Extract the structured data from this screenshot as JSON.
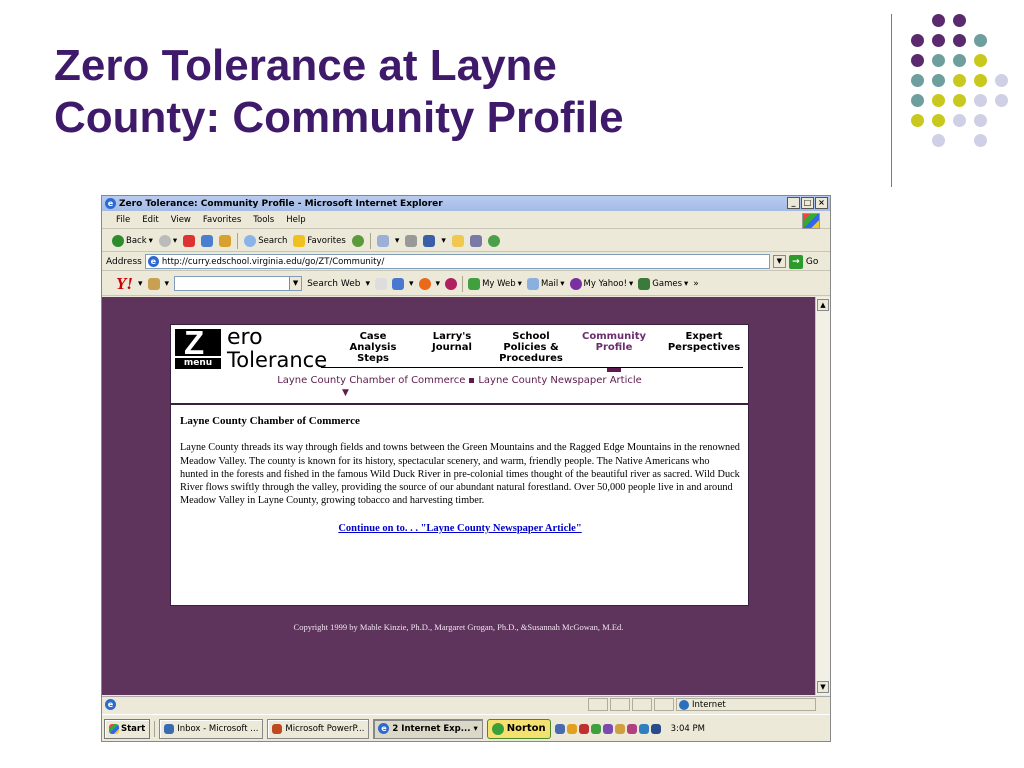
{
  "slide": {
    "title_line1": "Zero Tolerance at Layne",
    "title_line2": "County: Community Profile",
    "title_color": "#3f1a6b",
    "dot_colors": {
      "purple": "#5b2a6e",
      "teal": "#6e9f9e",
      "yellow": "#c8c81e",
      "lavender": "#cfd0e6"
    }
  },
  "window": {
    "title": "Zero Tolerance: Community Profile - Microsoft Internet Explorer",
    "controls": [
      "_",
      "□",
      "×"
    ]
  },
  "menubar": [
    "File",
    "Edit",
    "View",
    "Favorites",
    "Tools",
    "Help"
  ],
  "toolbar": {
    "back": "Back",
    "search": "Search",
    "favorites": "Favorites"
  },
  "address": {
    "label": "Address",
    "url": "http://curry.edschool.virginia.edu/go/ZT/Community/",
    "go": "Go"
  },
  "yahoo_toolbar": {
    "logo": "Y!",
    "search_btn": "Search Web",
    "my_web": "My Web",
    "mail": "Mail",
    "my_yahoo": "My Yahoo!",
    "games": "Games",
    "more": "»"
  },
  "site": {
    "logo_letter": "Z",
    "logo_menu": "menu",
    "logo_text1": "ero",
    "logo_text2": "Tolerance",
    "nav": [
      {
        "label": "Case Analysis Steps"
      },
      {
        "label": "Larry's Journal"
      },
      {
        "label": "School Policies & Procedures"
      },
      {
        "label": "Community Profile"
      },
      {
        "label": "Expert Perspectives"
      }
    ],
    "subnav_1": "Layne County Chamber of Commerce",
    "subnav_2": "Layne County Newspaper Article",
    "heading": "Layne County Chamber of Commerce",
    "paragraph": "Layne County threads its way through fields and towns between the Green Mountains and the Ragged Edge Mountains in the renowned Meadow Valley. The county is known for its history, spectacular scenery, and warm, friendly people. The Native Americans who hunted in the forests and fished in the famous Wild Duck River in pre-colonial times thought of the beautiful river as sacred. Wild Duck River flows swiftly through the valley, providing the source of our abundant natural forestland. Over 50,000 people live in and around Meadow Valley in Layne County, growing tobacco and harvesting timber.",
    "continue_link": "Continue on to. . . \"Layne County Newspaper Article\"",
    "copyright": "Copyright 1999 by Mable Kinzie, Ph.D., Margaret Grogan, Ph.D., &Susannah McGowan, M.Ed.",
    "bg_color": "#5e345d"
  },
  "statusbar": {
    "zone": "Internet"
  },
  "taskbar": {
    "start": "Start",
    "tasks": [
      "Inbox - Microsoft ...",
      "Microsoft PowerP...",
      "2 Internet Exp..."
    ],
    "norton": "Norton",
    "clock": "3:04 PM"
  }
}
